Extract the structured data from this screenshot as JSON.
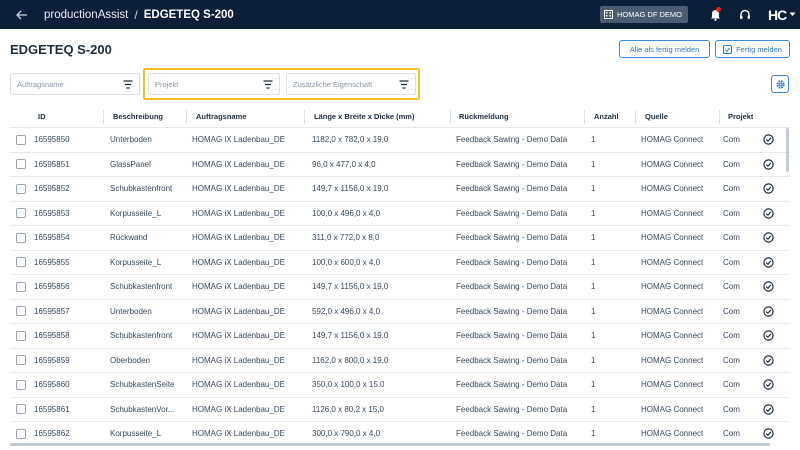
{
  "header": {
    "app_name": "productionAssist",
    "separator": "/",
    "current": "EDGETEQ S-200",
    "device_label": "HOMAG DF DEMO",
    "logo_text": "HC"
  },
  "page": {
    "title": "EDGETEQ S-200",
    "btn_all_done": "Alle als fertig melden",
    "btn_done": "Fertig melden"
  },
  "filters": {
    "auftragsname": "Auftragsname",
    "projekt": "Projekt",
    "eigenschaft": "Zusätzliche Eigenschaft"
  },
  "table": {
    "columns": [
      "ID",
      "Beschreibung",
      "Auftragsname",
      "Länge x Breite x Dicke (mm)",
      "Rückmeldung",
      "Anzahl",
      "Quelle",
      "Projekt"
    ],
    "rows": [
      [
        "16595850",
        "Unterboden",
        "HOMAG iX Ladenbau_DE",
        "1182,0 x 782,0 x 19,0",
        "Feedback Sawing - Demo Data",
        "1",
        "HOMAG Connect",
        "Com"
      ],
      [
        "16595851",
        "GlassPanel",
        "HOMAG iX Ladenbau_DE",
        "96,0 x 477,0 x 4,0",
        "Feedback Sawing - Demo Data",
        "1",
        "HOMAG Connect",
        "Com"
      ],
      [
        "16595852",
        "Schubkastenfront",
        "HOMAG iX Ladenbau_DE",
        "149,7 x 1156,0 x 19,0",
        "Feedback Sawing - Demo Data",
        "1",
        "HOMAG Connect",
        "Com"
      ],
      [
        "16595853",
        "Korpusseite_L",
        "HOMAG iX Ladenbau_DE",
        "100,0 x 496,0 x 4,0",
        "Feedback Sawing - Demo Data",
        "1",
        "HOMAG Connect",
        "Com"
      ],
      [
        "16595854",
        "Rückwand",
        "HOMAG iX Ladenbau_DE",
        "311,0 x 772,0 x 8,0",
        "Feedback Sawing - Demo Data",
        "1",
        "HOMAG Connect",
        "Com"
      ],
      [
        "16595855",
        "Korpusseite_L",
        "HOMAG iX Ladenbau_DE",
        "100,0 x 600,0 x 4,0",
        "Feedback Sawing - Demo Data",
        "1",
        "HOMAG Connect",
        "Com"
      ],
      [
        "16595856",
        "Schubkastenfront",
        "HOMAG iX Ladenbau_DE",
        "149,7 x 1156,0 x 19,0",
        "Feedback Sawing - Demo Data",
        "1",
        "HOMAG Connect",
        "Com"
      ],
      [
        "16595857",
        "Unterboden",
        "HOMAG iX Ladenbau_DE",
        "592,0 x 496,0 x 4,0",
        "Feedback Sawing - Demo Data",
        "1",
        "HOMAG Connect",
        "Com"
      ],
      [
        "16595858",
        "Schubkastenfront",
        "HOMAG iX Ladenbau_DE",
        "149,7 x 1156,0 x 19,0",
        "Feedback Sawing - Demo Data",
        "1",
        "HOMAG Connect",
        "Com"
      ],
      [
        "16595859",
        "Oberboden",
        "HOMAG iX Ladenbau_DE",
        "1162,0 x 800,0 x 19,0",
        "Feedback Sawing - Demo Data",
        "1",
        "HOMAG Connect",
        "Com"
      ],
      [
        "16595860",
        "SchubkastenSeite",
        "HOMAG iX Ladenbau_DE",
        "350,0 x 100,0 x 15,0",
        "Feedback Sawing - Demo Data",
        "1",
        "HOMAG Connect",
        "Com"
      ],
      [
        "16595861",
        "SchubkastenVor...",
        "HOMAG iX Ladenbau_DE",
        "1126,0 x 80,2 x 15,0",
        "Feedback Sawing - Demo Data",
        "1",
        "HOMAG Connect",
        "Com"
      ],
      [
        "16595862",
        "Korpusseite_L",
        "HOMAG iX Ladenbau_DE",
        "300,0 x 790,0 x 4,0",
        "Feedback Sawing - Demo Data",
        "1",
        "HOMAG Connect",
        "Com"
      ]
    ]
  },
  "colors": {
    "topbar": "#0b1f3a",
    "accent": "#2f7ac8",
    "highlight": "#f3c623",
    "notification": "#e2231a"
  },
  "icons": {
    "back": "arrow-left-icon",
    "device": "building-icon",
    "bell": "bell-icon",
    "support": "headset-icon",
    "filter": "filter-icon",
    "settings": "gear-icon",
    "row_action": "check-circle-icon"
  }
}
